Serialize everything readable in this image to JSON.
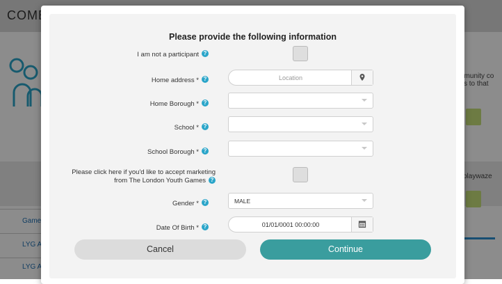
{
  "background": {
    "title_fragment": "COME",
    "right_text_1": "nmunity co\nss to that",
    "right_text_2": "playwaze",
    "left_links": [
      "Games",
      "LYG Ac",
      "LYG Ac"
    ]
  },
  "form": {
    "heading": "Please provide the following information",
    "not_participant_label": "I am not a participant",
    "home_address_label": "Home address *",
    "home_address_placeholder": "Location",
    "home_borough_label": "Home Borough *",
    "school_label": "School *",
    "school_borough_label": "School Borough *",
    "marketing_label_line1": "Please click here if you'd like to accept marketing",
    "marketing_label_line2": "from The London Youth Games",
    "gender_label": "Gender *",
    "gender_value": "MALE",
    "dob_label": "Date Of Birth *",
    "dob_value": "01/01/0001 00:00:00",
    "help_glyph": "?"
  },
  "buttons": {
    "cancel": "Cancel",
    "continue": "Continue"
  },
  "colors": {
    "accent": "#3a9d9e",
    "help": "#2aa5c9"
  }
}
